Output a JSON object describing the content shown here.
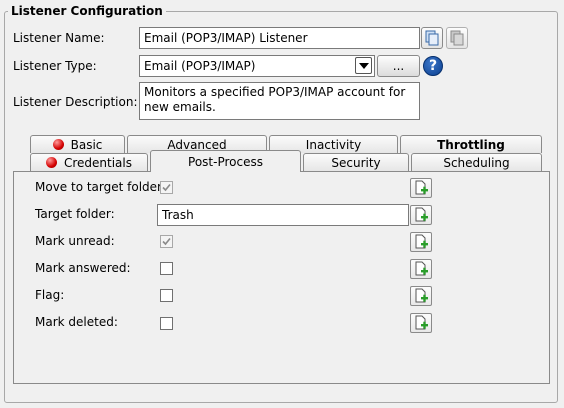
{
  "section": {
    "title": "Listener Configuration"
  },
  "fields": {
    "name": {
      "label": "Listener Name:",
      "value": "Email (POP3/IMAP) Listener"
    },
    "type": {
      "label": "Listener Type:",
      "value": "Email (POP3/IMAP)",
      "browse_label": "..."
    },
    "description": {
      "label": "Listener Description:",
      "value": "Monitors a specified POP3/IMAP account for new emails."
    }
  },
  "tabs": {
    "row_back": [
      {
        "label": "Basic",
        "error": true
      },
      {
        "label": "Advanced",
        "error": false
      },
      {
        "label": "Inactivity",
        "error": false
      },
      {
        "label": "Throttling",
        "error": false,
        "bold": true
      }
    ],
    "row_front": [
      {
        "label": "Credentials",
        "error": true
      },
      {
        "label": "Post-Process",
        "error": false,
        "active": true
      },
      {
        "label": "Security",
        "error": false
      },
      {
        "label": "Scheduling",
        "error": false
      }
    ]
  },
  "post_process": {
    "move_to_target": {
      "label": "Move to target folder:",
      "checked": true,
      "disabled": true
    },
    "target_folder": {
      "label": "Target folder:",
      "value": "Trash"
    },
    "mark_unread": {
      "label": "Mark unread:",
      "checked": true,
      "disabled": true
    },
    "mark_answered": {
      "label": "Mark answered:",
      "checked": false
    },
    "flag": {
      "label": "Flag:",
      "checked": false
    },
    "mark_deleted": {
      "label": "Mark deleted:",
      "checked": false
    }
  },
  "colors": {
    "error_dot": "#d40000",
    "help_icon": "#0b3f8f",
    "add_plus": "#2a9d2a"
  },
  "icons": {
    "help": "question-mark-icon",
    "copy": "copy-icon",
    "add_variable": "add-variable-icon"
  },
  "help_glyph": "?"
}
